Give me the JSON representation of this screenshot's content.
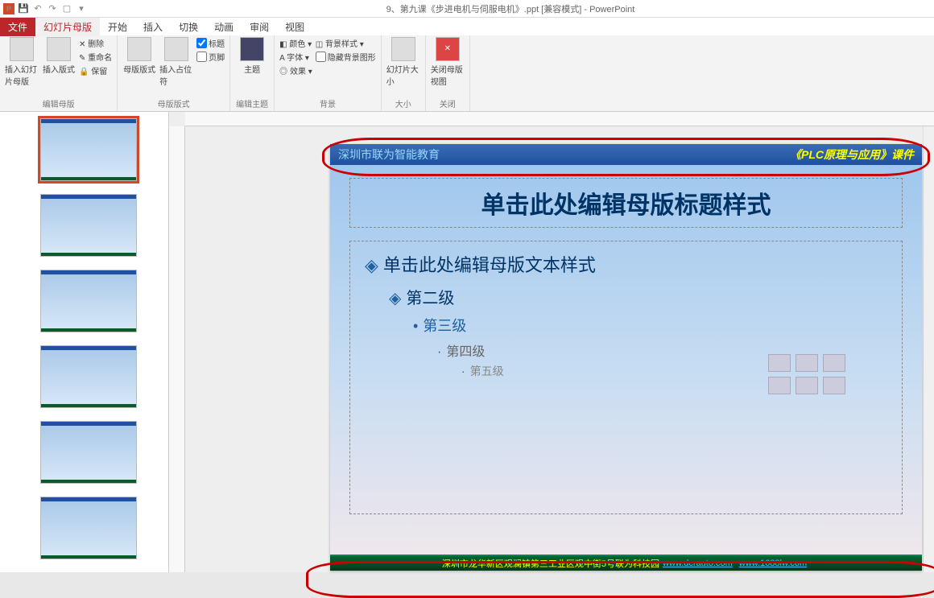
{
  "titlebar": {
    "title": "9、第九课《步进电机与伺服电机》.ppt [兼容模式] - PowerPoint"
  },
  "tabs": {
    "file": "文件",
    "master": "幻灯片母版",
    "home": "开始",
    "insert": "插入",
    "transition": "切换",
    "animation": "动画",
    "review": "审阅",
    "view": "视图"
  },
  "ribbon": {
    "g1": {
      "insert_master": "插入幻灯片母版",
      "insert_layout": "插入版式",
      "delete": "删除",
      "rename": "重命名",
      "preserve": "保留",
      "group": "编辑母版"
    },
    "g2": {
      "master_layout": "母版版式",
      "insert_placeholder": "插入占位符",
      "title": "标题",
      "footer": "页脚",
      "group": "母版版式"
    },
    "g3": {
      "theme": "主题",
      "group": "编辑主题"
    },
    "g4": {
      "colors": "颜色",
      "fonts": "字体",
      "effects": "效果",
      "bg_styles": "背景样式",
      "hide_bg": "隐藏背景图形",
      "group": "背景"
    },
    "g5": {
      "slide_size": "幻灯片大小",
      "group": "大小"
    },
    "g6": {
      "close": "关闭母版视图",
      "group": "关闭"
    }
  },
  "slide": {
    "hdr_left": "深圳市联为智能教育",
    "hdr_right": "《PLC原理与应用》课件",
    "title": "单击此处编辑母版标题样式",
    "l1": "单击此处编辑母版文本样式",
    "l2": "第二级",
    "l3": "第三级",
    "l4": "第四级",
    "l5": "第五级",
    "footer_text": "深圳市龙华新区观澜镇第三工业区观中街5号联为科技园",
    "footer_link1": "www.dcrauto.com",
    "footer_link2": "www.1688lw.com"
  }
}
